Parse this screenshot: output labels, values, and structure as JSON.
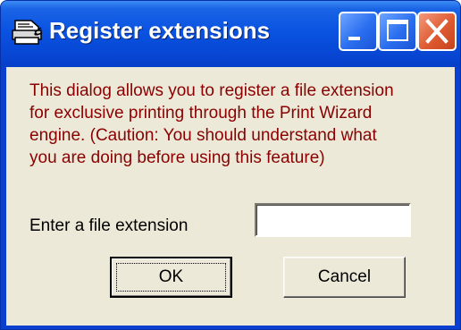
{
  "window": {
    "title": "Register extensions",
    "icon": "printer-wizard-icon",
    "controls": [
      "minimize-icon",
      "maximize-icon",
      "close-icon"
    ]
  },
  "dialog": {
    "message": "This dialog allows you to register a file extension\nfor exclusive printing through the Print Wizard\nengine.   (Caution: You should understand what\nyou are doing before using this feature)",
    "extension_label": "Enter a file extension",
    "extension_value": "",
    "ok_label": "OK",
    "cancel_label": "Cancel"
  },
  "colors": {
    "titlebar": "#0a53e1",
    "client": "#ece9d8",
    "message_text": "#8b0000",
    "close_button": "#de5a31"
  }
}
